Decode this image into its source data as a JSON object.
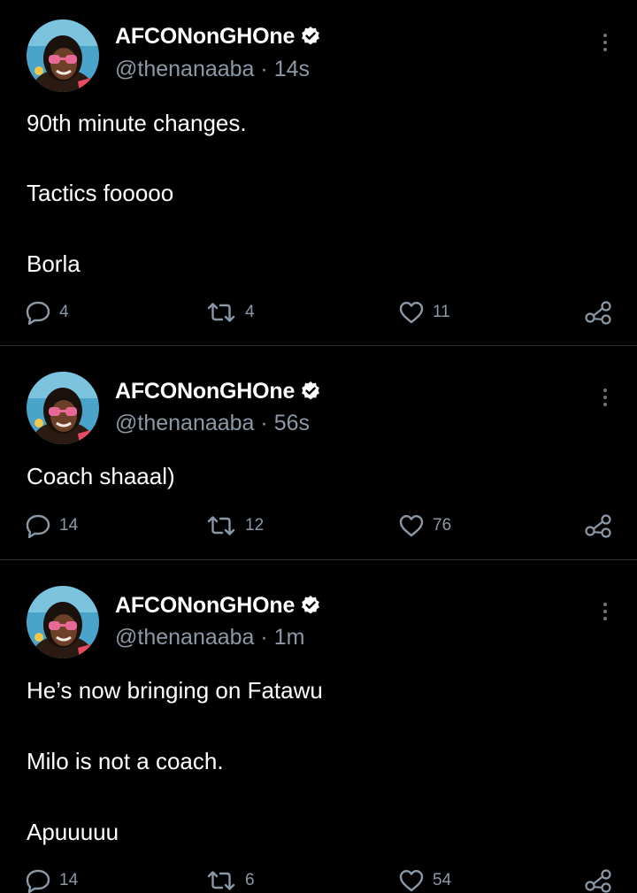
{
  "colors": {
    "background": "#000000",
    "text": "#ffffff",
    "secondary_text": "#8b98a5",
    "divider": "#2f3336",
    "verified_badge": "#ffffff"
  },
  "icons": {
    "more": "more-vertical-icon",
    "reply": "reply-icon",
    "retweet": "retweet-icon",
    "like": "heart-icon",
    "share": "share-icon",
    "verified": "verified-badge-icon"
  },
  "tweets": [
    {
      "display_name": "AFCONonGHOne",
      "handle": "@thenanaaba",
      "separator": " · ",
      "time": "14s",
      "paragraphs": [
        "90th minute changes.",
        "Tactics fooooo",
        "Borla"
      ],
      "replies": "4",
      "retweets": "4",
      "likes": "11"
    },
    {
      "display_name": "AFCONonGHOne",
      "handle": "@thenanaaba",
      "separator": " · ",
      "time": "56s",
      "paragraphs": [
        "Coach shaaal)"
      ],
      "replies": "14",
      "retweets": "12",
      "likes": "76"
    },
    {
      "display_name": "AFCONonGHOne",
      "handle": "@thenanaaba",
      "separator": " · ",
      "time": "1m",
      "paragraphs": [
        "He’s now bringing on Fatawu",
        "Milo is not a coach.",
        "Apuuuuu"
      ],
      "replies": "14",
      "retweets": "6",
      "likes": "54"
    }
  ]
}
